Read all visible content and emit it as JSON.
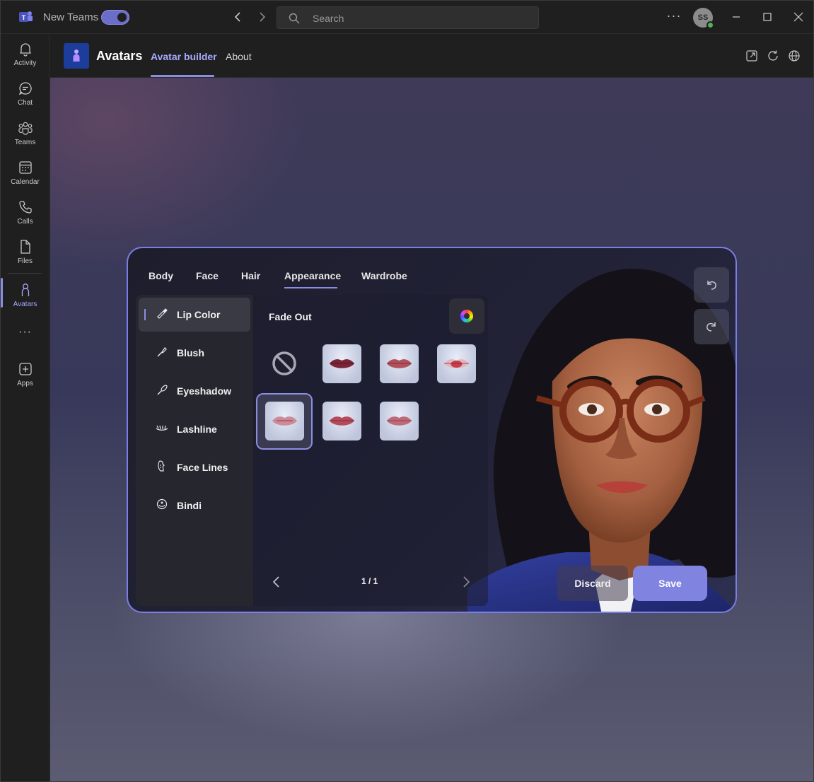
{
  "titlebar": {
    "app_name": "New Teams",
    "search_placeholder": "Search",
    "more_label": "···",
    "user_initials": "SS"
  },
  "rail": {
    "items": [
      {
        "label": "Activity",
        "icon": "bell-icon"
      },
      {
        "label": "Chat",
        "icon": "chat-icon"
      },
      {
        "label": "Teams",
        "icon": "teams-icon"
      },
      {
        "label": "Calendar",
        "icon": "calendar-icon"
      },
      {
        "label": "Calls",
        "icon": "phone-icon"
      },
      {
        "label": "Files",
        "icon": "file-icon"
      },
      {
        "label": "Avatars",
        "icon": "person-icon",
        "active": true
      },
      {
        "label": "Apps",
        "icon": "add-app-icon"
      }
    ],
    "more_label": "···"
  },
  "header": {
    "title": "Avatars",
    "tabs": [
      {
        "label": "Avatar builder",
        "active": true
      },
      {
        "label": "About"
      }
    ]
  },
  "builder": {
    "categories": [
      {
        "label": "Body"
      },
      {
        "label": "Face"
      },
      {
        "label": "Hair"
      },
      {
        "label": "Appearance",
        "active": true
      },
      {
        "label": "Wardrobe"
      }
    ],
    "side_items": [
      {
        "label": "Lip Color",
        "icon": "lipstick-icon",
        "active": true
      },
      {
        "label": "Blush",
        "icon": "brush-icon"
      },
      {
        "label": "Eyeshadow",
        "icon": "eyeshadow-brush-icon"
      },
      {
        "label": "Lashline",
        "icon": "lashline-icon"
      },
      {
        "label": "Face Lines",
        "icon": "face-lines-icon"
      },
      {
        "label": "Bindi",
        "icon": "bindi-icon"
      }
    ],
    "options_title": "Fade Out",
    "swatches": [
      {
        "id": "none"
      },
      {
        "color": "#7a2435"
      },
      {
        "color": "#b0505a"
      },
      {
        "color": "#c43f4b"
      },
      {
        "color": "#c98c98",
        "selected": true
      },
      {
        "color": "#b54a5c"
      },
      {
        "color": "#bf6a78"
      }
    ],
    "pager": "1 / 1",
    "discard_label": "Discard",
    "save_label": "Save"
  },
  "colors": {
    "accent": "#8b8ee0",
    "accent_text": "#a6a9ff",
    "save_button": "#8084e0"
  }
}
